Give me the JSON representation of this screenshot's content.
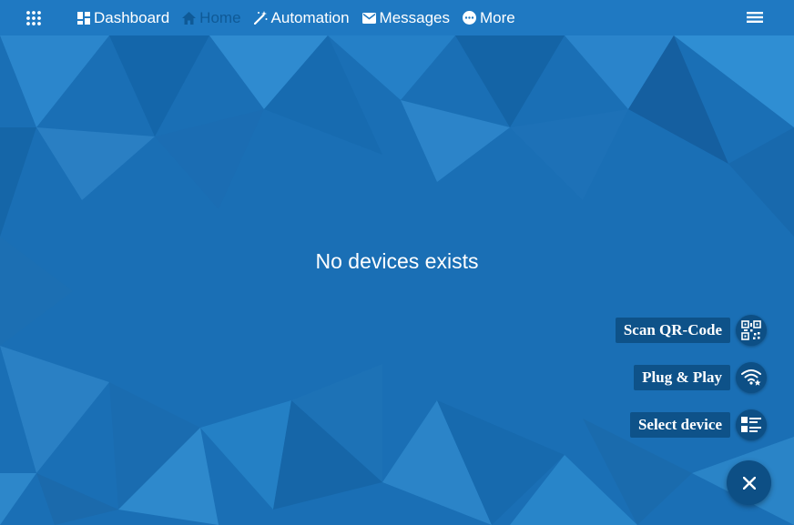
{
  "nav": {
    "items": [
      {
        "label": "Dashboard",
        "icon": "dashboard-icon",
        "active": false
      },
      {
        "label": "Home",
        "icon": "home-icon",
        "active": true
      },
      {
        "label": "Automation",
        "icon": "magic-wand-icon",
        "active": false
      },
      {
        "label": "Messages",
        "icon": "envelope-icon",
        "active": false
      },
      {
        "label": "More",
        "icon": "more-dots-icon",
        "active": false
      }
    ]
  },
  "main": {
    "empty_message": "No devices exists"
  },
  "fab": {
    "actions": [
      {
        "label": "Scan QR-Code",
        "icon": "qr-code-icon"
      },
      {
        "label": "Plug & Play",
        "icon": "wifi-star-icon"
      },
      {
        "label": "Select device",
        "icon": "list-icon"
      }
    ],
    "close_icon": "close-icon"
  },
  "colors": {
    "topbar": "#1f79c2",
    "background": "#1a6fb5",
    "active_nav": "#0f5a97",
    "fab": "#0d4f85"
  }
}
